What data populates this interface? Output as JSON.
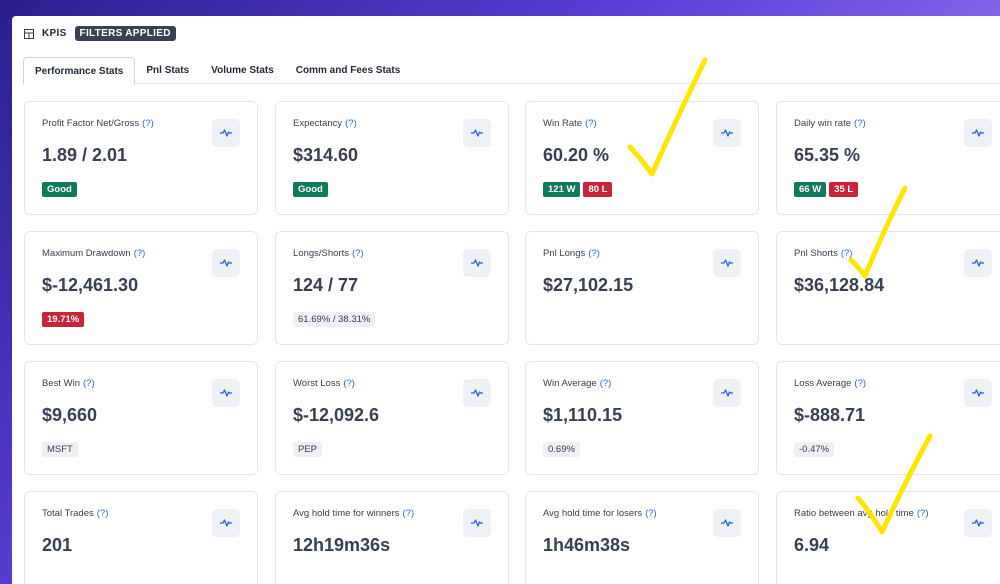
{
  "header": {
    "title": "KPIS",
    "badge": "FILTERS APPLIED",
    "icon": "table-icon"
  },
  "tabs": [
    {
      "label": "Performance Stats",
      "active": true
    },
    {
      "label": "Pnl Stats",
      "active": false
    },
    {
      "label": "Volume Stats",
      "active": false
    },
    {
      "label": "Comm and Fees Stats",
      "active": false
    }
  ],
  "help_marker": "(?)",
  "colors": {
    "good": "#0f7a5c",
    "bad": "#c8253a",
    "checkmark": "#ffe600"
  },
  "cards": [
    {
      "label": "Profit Factor Net/Gross",
      "value": "1.89 / 2.01",
      "tags": [
        {
          "text": "Good",
          "style": "green"
        }
      ]
    },
    {
      "label": "Expectancy",
      "value": "$314.60",
      "tags": [
        {
          "text": "Good",
          "style": "green"
        }
      ]
    },
    {
      "label": "Win Rate",
      "value": "60.20 %",
      "tags": [
        {
          "text": "121 W",
          "style": "green"
        },
        {
          "text": "80 L",
          "style": "red"
        }
      ]
    },
    {
      "label": "Daily win rate",
      "value": "65.35 %",
      "tags": [
        {
          "text": "66 W",
          "style": "green"
        },
        {
          "text": "35 L",
          "style": "red"
        }
      ]
    },
    {
      "label": "Maximum Drawdown",
      "value": "$-12,461.30",
      "tags": [
        {
          "text": "19.71%",
          "style": "red"
        }
      ]
    },
    {
      "label": "Longs/Shorts",
      "value": "124 / 77",
      "tags": [
        {
          "text": "61.69% / 38.31%",
          "style": "gray"
        }
      ]
    },
    {
      "label": "Pnl Longs",
      "value": "$27,102.15",
      "tags": []
    },
    {
      "label": "Pnl Shorts",
      "value": "$36,128.84",
      "tags": []
    },
    {
      "label": "Best Win",
      "value": "$9,660",
      "tags": [
        {
          "text": "MSFT",
          "style": "gray"
        }
      ]
    },
    {
      "label": "Worst Loss",
      "value": "$-12,092.6",
      "tags": [
        {
          "text": "PEP",
          "style": "gray"
        }
      ]
    },
    {
      "label": "Win Average",
      "value": "$1,110.15",
      "tags": [
        {
          "text": "0.69%",
          "style": "gray"
        }
      ]
    },
    {
      "label": "Loss Average",
      "value": "$-888.71",
      "tags": [
        {
          "text": "-0.47%",
          "style": "gray"
        }
      ]
    },
    {
      "label": "Total Trades",
      "value": "201",
      "tags": []
    },
    {
      "label": "Avg hold time for winners",
      "value": "12h19m36s",
      "tags": []
    },
    {
      "label": "Avg hold time for losers",
      "value": "1h46m38s",
      "tags": []
    },
    {
      "label": "Ratio between avg hold time",
      "value": "6.94",
      "tags": []
    }
  ]
}
